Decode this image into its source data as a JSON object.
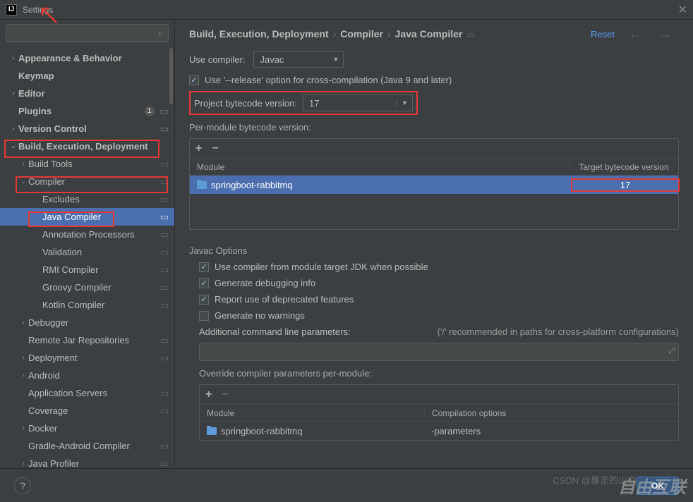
{
  "title": "Settings",
  "reset": "Reset",
  "sidebar": {
    "items": [
      {
        "label": "Appearance & Behavior",
        "chev": "›",
        "bold": true
      },
      {
        "label": "Keymap",
        "chev": "",
        "bold": true
      },
      {
        "label": "Editor",
        "chev": "›",
        "bold": true
      },
      {
        "label": "Plugins",
        "chev": "",
        "bold": true,
        "badge": "1",
        "cfg": true
      },
      {
        "label": "Version Control",
        "chev": "›",
        "bold": true,
        "cfg": true
      },
      {
        "label": "Build, Execution, Deployment",
        "chev": "⌄",
        "bold": true
      },
      {
        "label": "Build Tools",
        "chev": "›",
        "indent": 1,
        "cfg": true
      },
      {
        "label": "Compiler",
        "chev": "⌄",
        "indent": 1,
        "cfg": true
      },
      {
        "label": "Excludes",
        "chev": "",
        "indent": 2,
        "cfg": true
      },
      {
        "label": "Java Compiler",
        "chev": "",
        "indent": 2,
        "cfg": true,
        "selected": true
      },
      {
        "label": "Annotation Processors",
        "chev": "",
        "indent": 2,
        "cfg": true
      },
      {
        "label": "Validation",
        "chev": "",
        "indent": 2,
        "cfg": true
      },
      {
        "label": "RMI Compiler",
        "chev": "",
        "indent": 2,
        "cfg": true
      },
      {
        "label": "Groovy Compiler",
        "chev": "",
        "indent": 2,
        "cfg": true
      },
      {
        "label": "Kotlin Compiler",
        "chev": "",
        "indent": 2,
        "cfg": true
      },
      {
        "label": "Debugger",
        "chev": "›",
        "indent": 1
      },
      {
        "label": "Remote Jar Repositories",
        "chev": "",
        "indent": 1,
        "cfg": true
      },
      {
        "label": "Deployment",
        "chev": "›",
        "indent": 1,
        "cfg": true
      },
      {
        "label": "Android",
        "chev": "›",
        "indent": 1
      },
      {
        "label": "Application Servers",
        "chev": "",
        "indent": 1,
        "cfg": true
      },
      {
        "label": "Coverage",
        "chev": "",
        "indent": 1,
        "cfg": true
      },
      {
        "label": "Docker",
        "chev": "›",
        "indent": 1
      },
      {
        "label": "Gradle-Android Compiler",
        "chev": "",
        "indent": 1,
        "cfg": true
      },
      {
        "label": "Java Profiler",
        "chev": "›",
        "indent": 1,
        "cfg": true
      }
    ]
  },
  "breadcrumb": {
    "a": "Build, Execution, Deployment",
    "b": "Compiler",
    "c": "Java Compiler"
  },
  "form": {
    "use_compiler_label": "Use compiler:",
    "use_compiler_value": "Javac",
    "release_option": "Use '--release' option for cross-compilation (Java 9 and later)",
    "project_bytecode_label": "Project bytecode version:",
    "project_bytecode_value": "17",
    "per_module_label": "Per-module bytecode version:",
    "module_header": "Module",
    "target_header": "Target bytecode version",
    "module_name": "springboot-rabbitmq",
    "module_target": "17",
    "javac_options": "Javac Options",
    "cb1": "Use compiler from module target JDK when possible",
    "cb2": "Generate debugging info",
    "cb3": "Report use of deprecated features",
    "cb4": "Generate no warnings",
    "addl_params_label": "Additional command line parameters:",
    "addl_hint": "('/' recommended in paths for cross-platform configurations)",
    "override_label": "Override compiler parameters per-module:",
    "comp_options_header": "Compilation options",
    "comp_module": "springboot-rabbitmq",
    "comp_value": "-parameters"
  },
  "buttons": {
    "ok": "OK",
    "help": "?"
  },
  "watermark": "自由互联",
  "watermark2": "CSDN @暴走的山交"
}
